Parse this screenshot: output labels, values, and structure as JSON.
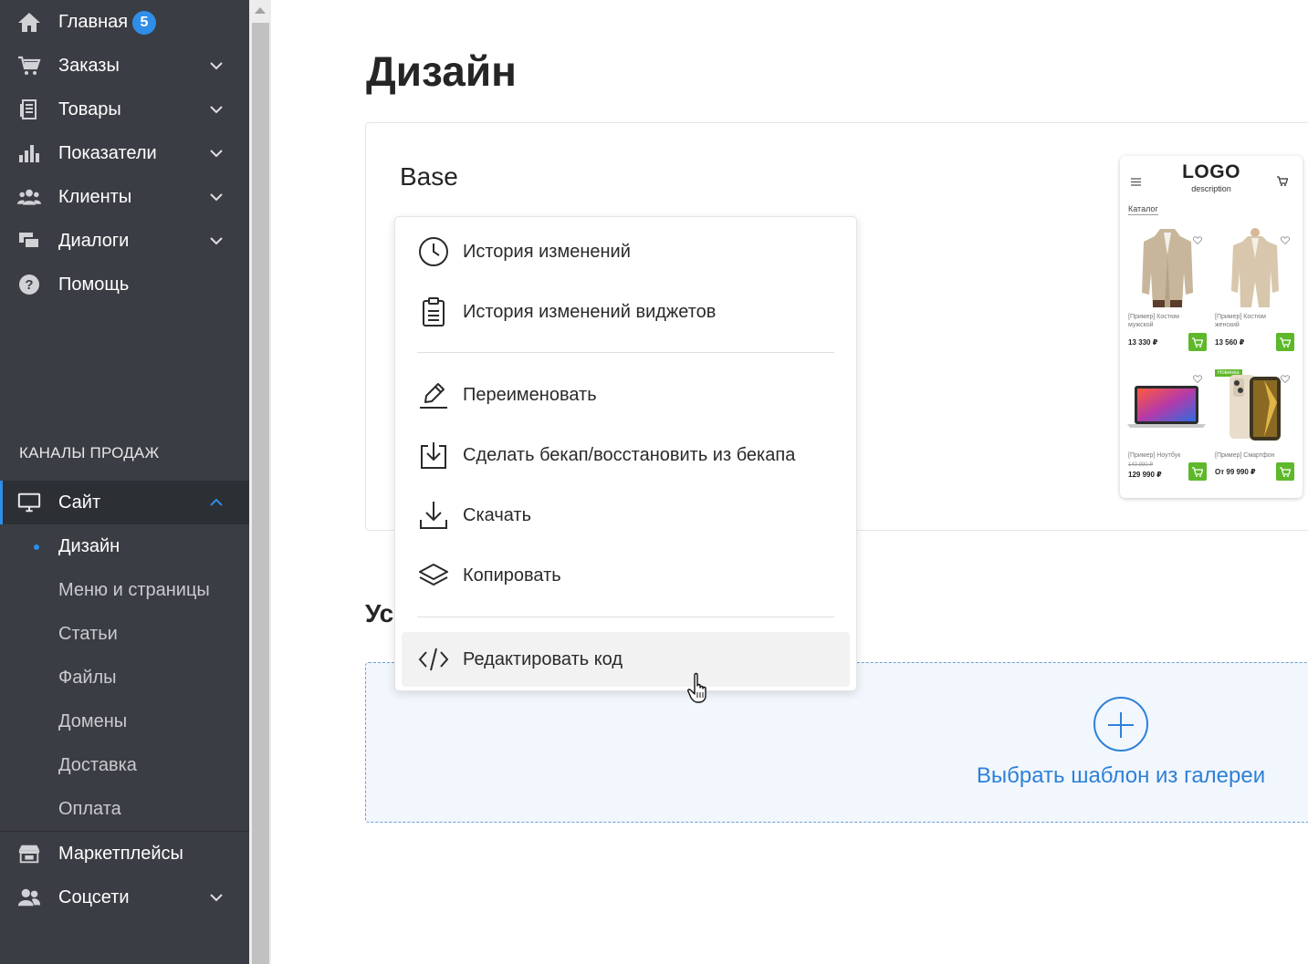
{
  "sidebar": {
    "items": [
      {
        "label": "Главная",
        "icon": "home-icon",
        "badge": "5"
      },
      {
        "label": "Заказы",
        "icon": "cart-icon"
      },
      {
        "label": "Товары",
        "icon": "products-icon"
      },
      {
        "label": "Показатели",
        "icon": "chart-icon"
      },
      {
        "label": "Клиенты",
        "icon": "clients-icon"
      },
      {
        "label": "Диалоги",
        "icon": "dialogs-icon"
      },
      {
        "label": "Помощь",
        "icon": "help-icon"
      }
    ],
    "section_title": "КАНАЛЫ ПРОДАЖ",
    "site": {
      "label": "Сайт",
      "icon": "monitor-icon"
    },
    "site_sub": [
      "Дизайн",
      "Меню и страницы",
      "Статьи",
      "Файлы",
      "Домены",
      "Доставка",
      "Оплата"
    ],
    "marketplaces": {
      "label": "Маркетплейсы",
      "icon": "store-icon"
    },
    "social": {
      "label": "Соцсети",
      "icon": "social-icon"
    }
  },
  "main": {
    "title": "Дизайн",
    "card_title": "Base",
    "section2_title": "Ус",
    "gallery_link": "Выбрать шаблон из галереи"
  },
  "preview": {
    "logo": "LOGO",
    "description": "description",
    "catalog": "Каталог",
    "products": [
      {
        "name": "[Пример] Костюм мужской",
        "price": "13 330 ₽"
      },
      {
        "name": "[Пример] Костюм женский",
        "price": "13 560 ₽"
      },
      {
        "name": "[Пример] Ноутбук",
        "old_price": "140 990 ₽",
        "price": "129 990 ₽"
      },
      {
        "name": "[Пример] Смартфон",
        "price": "От 99 990 ₽",
        "badge": "Новинка"
      }
    ]
  },
  "menu": {
    "items": [
      {
        "label": "История изменений",
        "icon": "clock-icon"
      },
      {
        "label": "История изменений виджетов",
        "icon": "clipboard-icon"
      },
      {
        "label": "Переименовать",
        "icon": "pencil-icon"
      },
      {
        "label": "Сделать бекап/восстановить из бекапа",
        "icon": "backup-icon"
      },
      {
        "label": "Скачать",
        "icon": "download-icon"
      },
      {
        "label": "Копировать",
        "icon": "layers-icon"
      },
      {
        "label": "Редактировать код",
        "icon": "code-icon"
      }
    ]
  },
  "colors": {
    "sidebar_bg": "#3a3d43",
    "accent": "#2e8ee8",
    "green": "#5eb82a"
  }
}
